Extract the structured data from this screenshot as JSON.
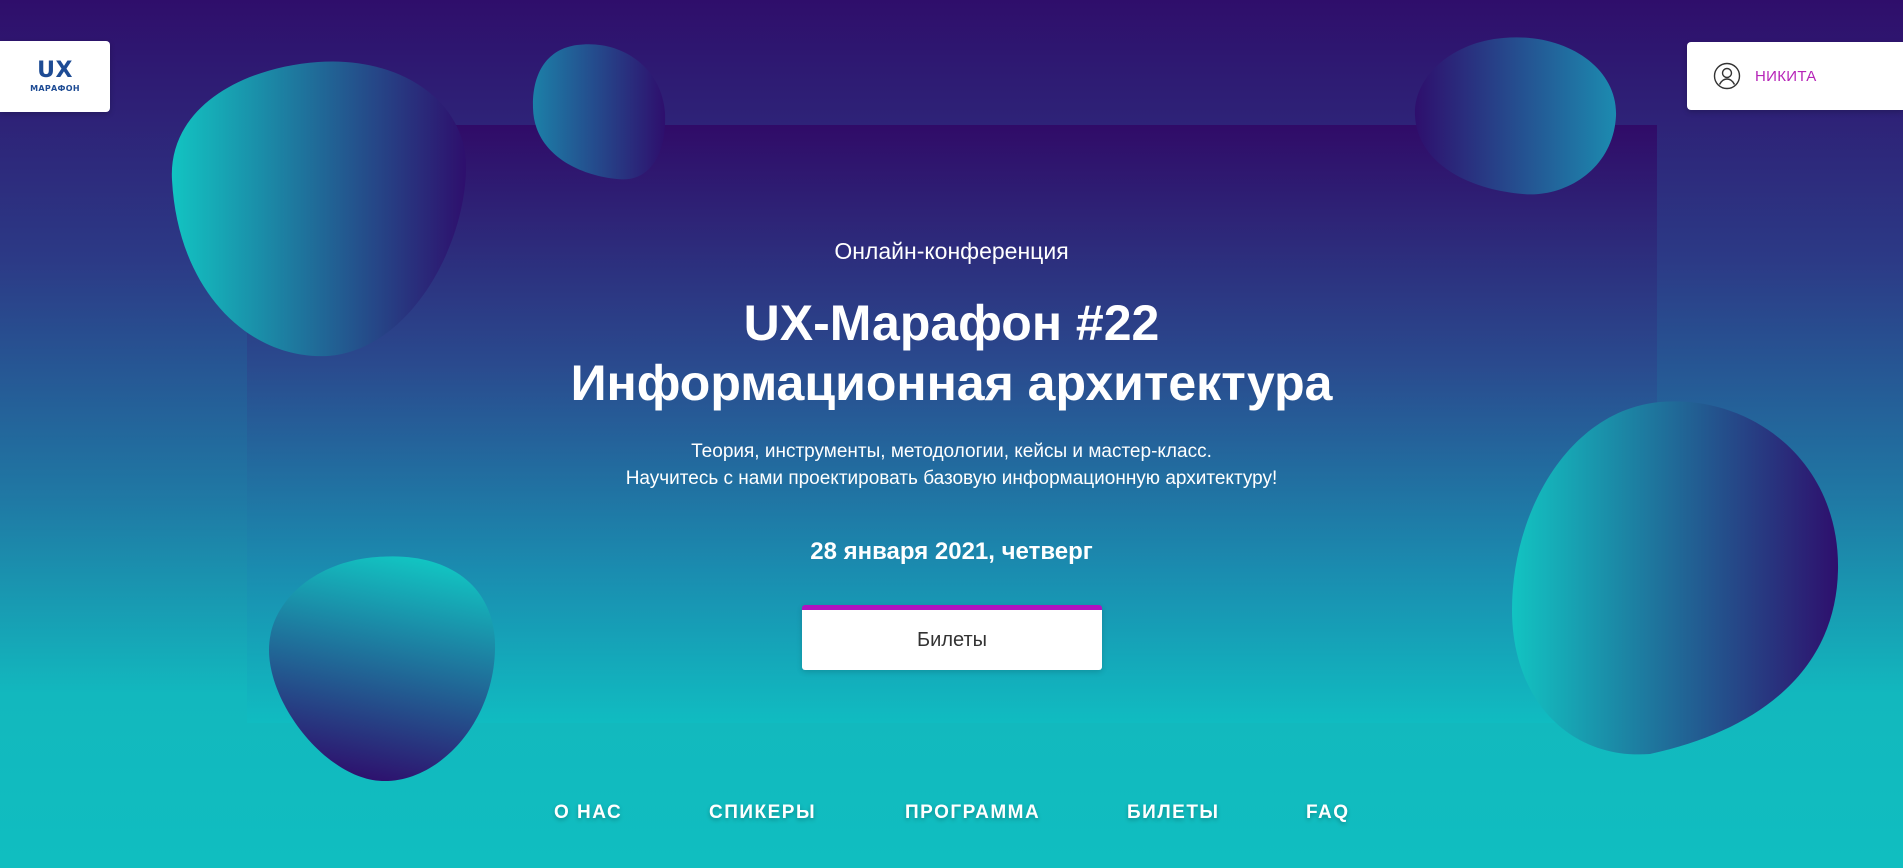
{
  "logo": {
    "main": "UX",
    "sub": "МАРАФОН"
  },
  "user": {
    "icon": "user-circle-icon",
    "name": "НИКИТА"
  },
  "hero": {
    "eyebrow": "Онлайн-конференция",
    "title_line1": "UX-Марафон #22",
    "title_line2": "Информационная архитектура",
    "subtitle_line1": "Теория, инструменты, методологии, кейсы и мастер-класс.",
    "subtitle_line2": "Научитесь с нами проектировать базовую информационную архитектуру!",
    "date": "28 января 2021, четверг",
    "cta_label": "Билеты"
  },
  "nav": {
    "items": [
      {
        "label": "О НАС"
      },
      {
        "label": "СПИКЕРЫ"
      },
      {
        "label": "ПРОГРАММА"
      },
      {
        "label": "БИЛЕТЫ"
      },
      {
        "label": "FAQ"
      }
    ]
  },
  "colors": {
    "accent": "#b012c0",
    "user_name": "#b624b8",
    "logo": "#1d4b94",
    "blob_teal": "#12c2c2",
    "blob_purple": "#2e0f6d"
  }
}
